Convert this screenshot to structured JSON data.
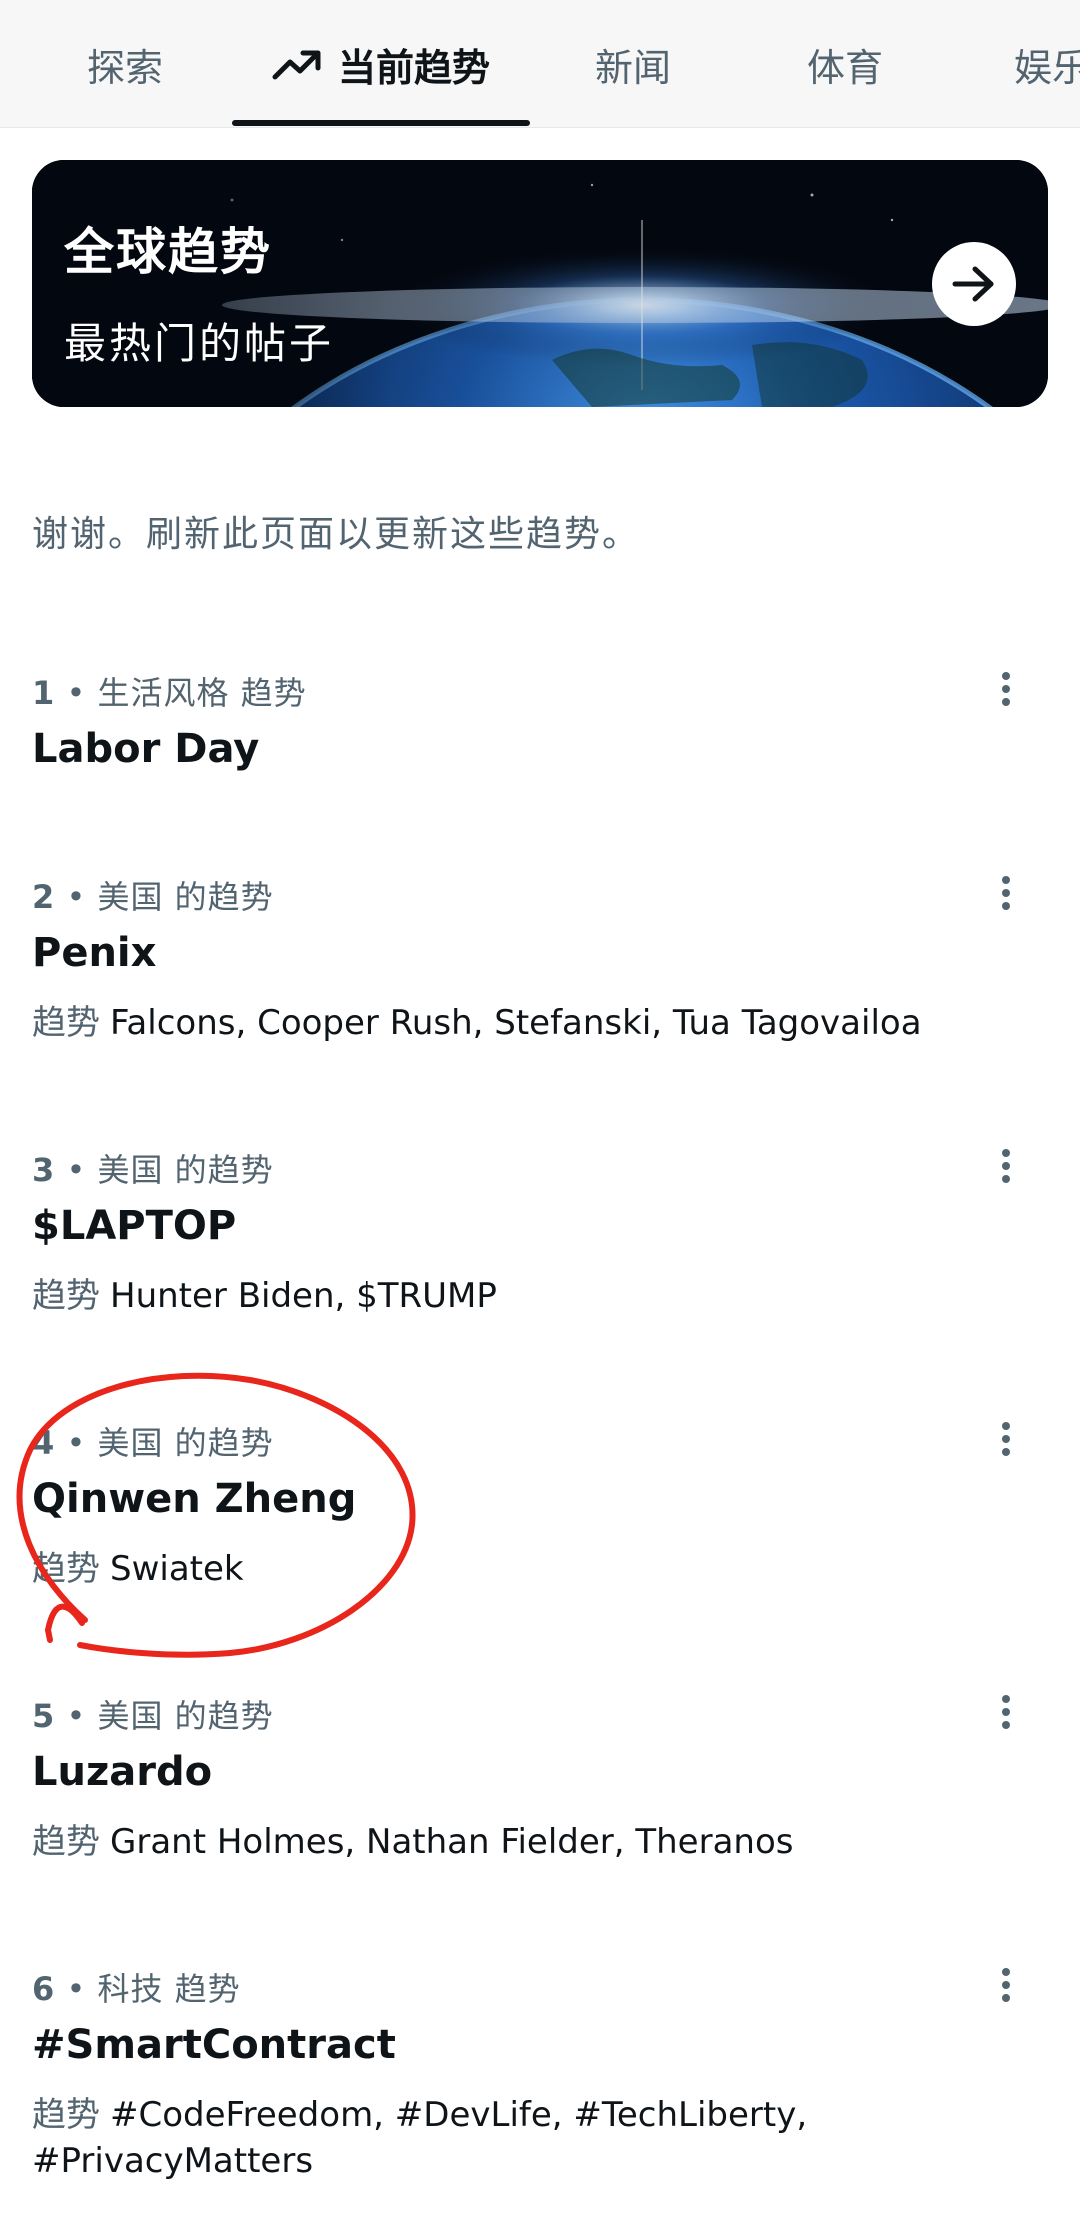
{
  "tabs": [
    {
      "label": "探索",
      "active": false,
      "icon": null
    },
    {
      "label": "当前趋势",
      "active": true,
      "icon": "trending-up-icon"
    },
    {
      "label": "新闻",
      "active": false,
      "icon": null
    },
    {
      "label": "体育",
      "active": false,
      "icon": null
    },
    {
      "label": "娱乐",
      "active": false,
      "icon": null
    }
  ],
  "banner": {
    "title": "全球趋势",
    "subtitle": "最热门的帖子",
    "button_icon": "arrow-right-icon"
  },
  "notice": "谢谢。刷新此页面以更新这些趋势。",
  "trend_prefix": "趋势",
  "trends": [
    {
      "rank": "1",
      "category": "生活风格 趋势",
      "name": "Labor Day",
      "related": ""
    },
    {
      "rank": "2",
      "category": "美国 的趋势",
      "name": "Penix",
      "related": "Falcons, Cooper Rush, Stefanski, Tua Tagovailoa"
    },
    {
      "rank": "3",
      "category": "美国 的趋势",
      "name": "$LAPTOP",
      "related": "Hunter Biden, $TRUMP"
    },
    {
      "rank": "4",
      "category": "美国 的趋势",
      "name": "Qinwen Zheng",
      "related": "Swiatek"
    },
    {
      "rank": "5",
      "category": "美国 的趋势",
      "name": "Luzardo",
      "related": "Grant Holmes, Nathan Fielder, Theranos"
    },
    {
      "rank": "6",
      "category": "科技 趋势",
      "name": "#SmartContract",
      "related": "#CodeFreedom, #DevLife, #TechLiberty, #PrivacyMatters"
    }
  ],
  "more_icon": "more-vertical-icon",
  "colors": {
    "text_primary": "#0f1419",
    "text_secondary": "#536471",
    "annotation_circle": "#e8261c",
    "banner_background": "#03070f"
  }
}
